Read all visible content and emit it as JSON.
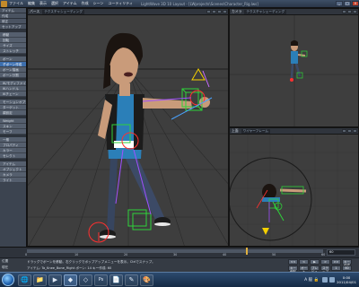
{
  "menubar": {
    "items": [
      "ファイル",
      "編集",
      "表示",
      "選択",
      "アイテム",
      "作成",
      "シーン",
      "ユーティリティ"
    ],
    "title": "LightWave 3D 10 Layout - [LWprojects\\Scenes\\Character_Rig.lws]",
    "minimize": "_",
    "maximize": "□",
    "close": "×"
  },
  "toolbar": {
    "tabs": [
      "アイテム",
      "作成",
      "修正",
      "セットアップ"
    ],
    "groups": [
      [
        "移動",
        "回転",
        "サイズ",
        "ストレッチ"
      ],
      [
        "ボーン",
        "子ボーン作成",
        "ボーン描画",
        "ボーン分割"
      ],
      [
        "IK/モディファイア",
        "IKハンドル",
        "IKチェーン"
      ],
      [
        "モーションオプション",
        "ターゲット",
        "親設定"
      ],
      [
        "Weight",
        "スキン",
        "モーフ"
      ],
      [
        "一般",
        "プロパティ",
        "カラー",
        "セレクト"
      ],
      [
        "アイテム",
        "オブジェクト",
        "カメラ",
        "ライト"
      ]
    ],
    "active_item": "子ボーン作成"
  },
  "viewports": {
    "main": {
      "label": "パース",
      "mode": "テクスチャシェーディング"
    },
    "top_right": {
      "label": "カメラ",
      "mode": "テクスチャシェーディング"
    },
    "bottom_right": {
      "label": "上面",
      "mode": "ワイヤーフレーム"
    }
  },
  "timeline": {
    "ticks": [
      "0",
      "10",
      "20",
      "30",
      "40",
      "50",
      "60"
    ],
    "playhead_fraction": 0.74,
    "current_frame": "60"
  },
  "status": {
    "label1": "位置",
    "label2": "現在",
    "line1": "ドラッグでボーンを移動。右クリックでポップアップメニューを表示。Ctrlでスナップ。",
    "line2": "アイテム: Ta_Knee_Bone_Right  ボーン: 14  キー作成: 60",
    "controls": [
      "<<",
      "<",
      "▶",
      ">",
      ">>",
      "キー作成",
      "キー削除",
      "オート",
      "プレビュー",
      "ステップ",
      "1",
      "60"
    ]
  },
  "taskbar": {
    "icons": [
      "ie",
      "folder",
      "media",
      "lightwave",
      "modeler",
      "photoshop",
      "pdf",
      "notes",
      "paint"
    ],
    "active_index": 3,
    "ime": "A 般 🔒",
    "time": "0:00",
    "date": "2011/04/01"
  },
  "colors": {
    "viewport_bg": "#3e3e3e",
    "grid": "#2a2a2a",
    "bone_green": "#2fd23a",
    "bone_red": "#ff3030",
    "accent_blue": "#3d6fae"
  }
}
